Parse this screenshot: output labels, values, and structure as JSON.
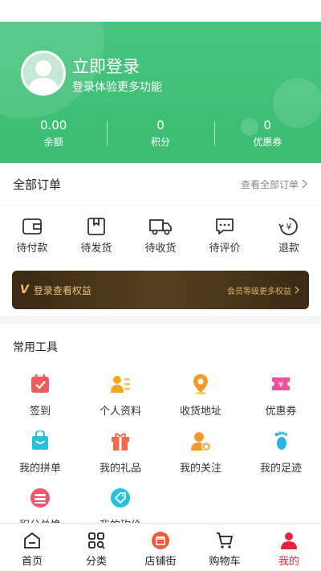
{
  "header": {
    "login_title": "立即登录",
    "login_subtitle": "登录体验更多功能",
    "stats": [
      {
        "value": "0.00",
        "label": "余额"
      },
      {
        "value": "0",
        "label": "积分"
      },
      {
        "value": "0",
        "label": "优惠券"
      }
    ]
  },
  "orders": {
    "title": "全部订单",
    "view_all": "查看全部订单",
    "items": [
      {
        "label": "待付款",
        "icon": "wallet-icon"
      },
      {
        "label": "待发货",
        "icon": "package-icon"
      },
      {
        "label": "待收货",
        "icon": "truck-icon"
      },
      {
        "label": "待评价",
        "icon": "comment-icon"
      },
      {
        "label": "退款",
        "icon": "refund-icon"
      }
    ]
  },
  "vip": {
    "badge": "V",
    "left_text": "登录查看权益",
    "right_text": "会员等级更多权益"
  },
  "tools": {
    "title": "常用工具",
    "items": [
      {
        "label": "签到",
        "icon": "calendar-check-icon",
        "color": "#f05a5a"
      },
      {
        "label": "个人资料",
        "icon": "profile-card-icon",
        "color": "#f5a623"
      },
      {
        "label": "收货地址",
        "icon": "location-pin-icon",
        "color": "#f39a2d"
      },
      {
        "label": "优惠券",
        "icon": "coupon-icon",
        "color": "#f04fa0"
      },
      {
        "label": "我的拼单",
        "icon": "shopping-bag-icon",
        "color": "#26c1e0"
      },
      {
        "label": "我的礼品",
        "icon": "gift-icon",
        "color": "#f26a4b"
      },
      {
        "label": "我的关注",
        "icon": "user-star-icon",
        "color": "#f39a2d"
      },
      {
        "label": "我的足迹",
        "icon": "footprint-icon",
        "color": "#2bb6e6"
      },
      {
        "label": "积分兑换",
        "icon": "points-stack-icon",
        "color": "#f0566a"
      },
      {
        "label": "我的砍价",
        "icon": "price-tag-icon",
        "color": "#26c1e0"
      }
    ]
  },
  "tabbar": {
    "items": [
      {
        "label": "首页",
        "icon": "home-icon"
      },
      {
        "label": "分类",
        "icon": "category-search-icon"
      },
      {
        "label": "店铺街",
        "icon": "store-icon"
      },
      {
        "label": "购物车",
        "icon": "cart-icon"
      },
      {
        "label": "我的",
        "icon": "user-icon"
      }
    ],
    "active_color": "#e8223c"
  },
  "colors": {
    "header_green": "#3fbf76",
    "accent_red": "#e8223c",
    "vip_gold": "#e9c27a"
  }
}
